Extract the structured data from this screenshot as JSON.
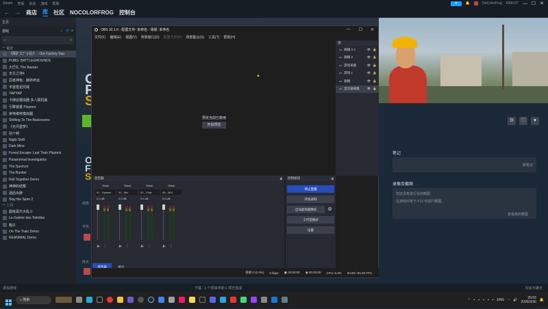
{
  "steam": {
    "menubar": [
      "Steam",
      "查看",
      "好友",
      "游戏",
      "帮助"
    ],
    "nav": {
      "store": "商店",
      "community": "社区",
      "user": "NOCOLORFROG",
      "console": "控制台"
    },
    "account": {
      "name": "NoColorFrog",
      "balance": "¥430.07"
    },
    "sidebar": {
      "home": "主页",
      "filter": "游戏",
      "section_recent": "一 最近",
      "section_month": "一 二月",
      "games_recent": [
        "《挥矿工厂小队》 - Ore Factory Squ",
        "PUBG: BATTLEGROUNDS",
        "大巴扎 The Bazaar",
        "无主之地4",
        "忍者神龟：破碎命运",
        "宇宙猎诅咒域",
        "YAPYAP",
        "卡牌店模拟器 多人联机版",
        "引擎装置 Playtest",
        "家电维修模拟器",
        "Shifting To The Backrooms",
        "《无尽噩梦》",
        "别个啊",
        "Night Shift",
        "Dark Mine",
        "Forest Escape: Last Train Playtest",
        "Paranormal Investigation",
        "The Survivor",
        "The Bunker",
        "Roll Together Demo",
        "神神的结冤",
        "酒后出牌",
        "Slay the Spire 2"
      ],
      "games_month": [
        "超级黑尔大乱斗",
        "La Galerie des Toilettes",
        "箱子",
        "On The Train Demo",
        "REANIMAL Demo"
      ]
    },
    "main": {
      "notes_title": "笔记",
      "notes_action": "新笔记",
      "recordings_title": "录像及截图",
      "recordings_line1": "您还没有进行任何截图",
      "recordings_line2": "在游戏中按下 F12 可进行截图。",
      "recordings_action": "查看我的截图",
      "label_dynamic": "动态",
      "label_today": "今天",
      "label_yesterday": "昨天"
    },
    "status": {
      "add_game": "添加游戏",
      "download": "下载 - 1 个项目中的 1 项已完成",
      "friends": "好友与聊天"
    }
  },
  "obs": {
    "title": "OBS 32.1.0 - 配置文件: 未命名 - 场景: 未命名",
    "menu": [
      "文件(F)",
      "编辑(E)",
      "视图(V)",
      "停靠窗口(D)",
      "配置文件(P)",
      "场景集合(S)",
      "工具(T)",
      "帮助(H)"
    ],
    "preview_notice": "预览当前已禁用",
    "preview_button": "开启预览",
    "sources_header": "源",
    "sources": [
      "跟播 2 2",
      "跟播 2",
      "游戏采集",
      "游戏 1",
      "跟播",
      "显示器采集"
    ],
    "mixer_header": "混音器",
    "channels": [
      {
        "global": "Global",
        "name": "01 - System",
        "db": "0.0 dB"
      },
      {
        "global": "Global",
        "name": "02 - Mic",
        "db": "0.0 dB"
      },
      {
        "global": "Global",
        "name": "03 - Chat",
        "db": "0.0 dB"
      },
      {
        "global": "Global",
        "name": "06 - MIX",
        "db": "0.0 dB"
      }
    ],
    "mixer_tabs": [
      "混音器",
      "统计"
    ],
    "controls_header": "控制按钮",
    "controls": {
      "stop_stream": "停止直播",
      "start_record": "开始录制",
      "virtual_cam": "启动虚拟摄像机",
      "studio_mode": "工作室模式",
      "settings": "设置"
    },
    "statusbar": {
      "dropped": "丢帧 0 (0.0%)",
      "bitrate": "0 kbps",
      "stream_time": "00:00:00",
      "record_time": "00:00:00",
      "cpu": "CPU: 0.3%",
      "fps": "60.00 / 60.00 FPS"
    }
  },
  "taskbar": {
    "search": "搜索",
    "lang": "ENG",
    "time": "20:03",
    "date": "2026/3/30"
  }
}
